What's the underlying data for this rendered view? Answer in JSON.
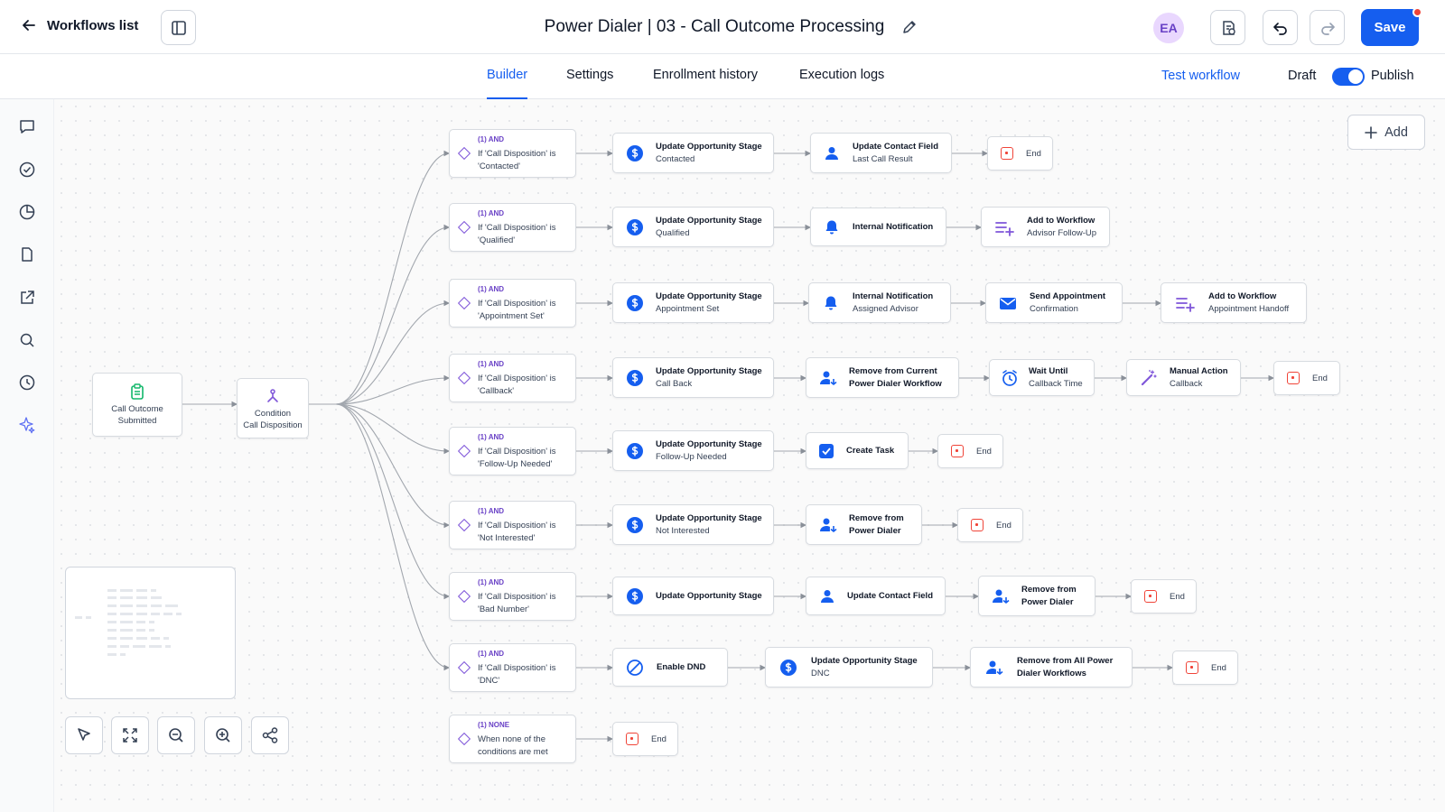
{
  "header": {
    "back_label": "Workflows list",
    "title": "Power Dialer | 03 - Call Outcome Processing",
    "avatar_initials": "EA",
    "save_label": "Save"
  },
  "tabs": [
    {
      "label": "Builder",
      "active": true
    },
    {
      "label": "Settings",
      "active": false
    },
    {
      "label": "Enrollment history",
      "active": false
    },
    {
      "label": "Execution logs",
      "active": false
    }
  ],
  "actions": {
    "test_workflow": "Test workflow",
    "draft_label": "Draft",
    "publish_label": "Publish",
    "publish_toggle_on": true
  },
  "canvas": {
    "add_label": "Add",
    "trigger": {
      "line1": "Call Outcome",
      "line2": "Submitted"
    },
    "condition": {
      "line1": "Condition",
      "line2": "Call Disposition"
    },
    "branch_tag": "(1) AND",
    "none_tag": "(1) NONE",
    "end_label": "End",
    "branches": [
      {
        "cond1": "If 'Call Disposition' is",
        "cond2": "'Contacted'"
      },
      {
        "cond1": "If 'Call Disposition' is",
        "cond2": "'Qualified'"
      },
      {
        "cond1": "If 'Call Disposition' is",
        "cond2": "'Appointment Set'"
      },
      {
        "cond1": "If 'Call Disposition' is",
        "cond2": "'Callback'"
      },
      {
        "cond1": "If 'Call Disposition' is",
        "cond2": "'Follow-Up Needed'"
      },
      {
        "cond1": "If 'Call Disposition' is",
        "cond2": "'Not Interested'"
      },
      {
        "cond1": "If 'Call Disposition' is",
        "cond2": "'Bad Number'"
      },
      {
        "cond1": "If 'Call Disposition' is",
        "cond2": "'DNC'"
      },
      {
        "cond1": "When none of the",
        "cond2": "conditions are met"
      }
    ],
    "actions": {
      "b0a1": {
        "title": "Update Opportunity Stage",
        "sub": "Contacted",
        "icon": "dollar-icon"
      },
      "b0a2": {
        "title": "Update Contact Field",
        "sub": "Last Call Result",
        "icon": "person-icon"
      },
      "b1a1": {
        "title": "Update Opportunity Stage",
        "sub": "Qualified",
        "icon": "dollar-icon"
      },
      "b1a2": {
        "title": "Internal Notification",
        "sub": "",
        "icon": "bell-icon"
      },
      "b1a3": {
        "title": "Add to Workflow",
        "sub": "Advisor Follow-Up",
        "icon": "list-add-icon"
      },
      "b2a1": {
        "title": "Update Opportunity Stage",
        "sub": "Appointment Set",
        "icon": "dollar-icon"
      },
      "b2a2": {
        "title": "Internal Notification",
        "sub": "Assigned Advisor",
        "icon": "bell-icon"
      },
      "b2a3": {
        "title": "Send Appointment",
        "sub": "Confirmation",
        "icon": "mail-icon"
      },
      "b2a4": {
        "title": "Add to Workflow",
        "sub": "Appointment Handoff",
        "icon": "list-add-icon"
      },
      "b3a1": {
        "title": "Update Opportunity Stage",
        "sub": "Call Back",
        "icon": "dollar-icon"
      },
      "b3a2": {
        "title": "Remove from Current",
        "sub": "Power Dialer Workflow",
        "icon": "person-remove-icon"
      },
      "b3a3": {
        "title": "Wait Until",
        "sub": "Callback Time",
        "icon": "clock-icon"
      },
      "b3a4": {
        "title": "Manual Action",
        "sub": "Callback",
        "icon": "wand-icon"
      },
      "b4a1": {
        "title": "Update Opportunity Stage",
        "sub": "Follow-Up Needed",
        "icon": "dollar-icon"
      },
      "b4a2": {
        "title": "Create Task",
        "sub": "",
        "icon": "task-icon"
      },
      "b5a1": {
        "title": "Update Opportunity Stage",
        "sub": "Not Interested",
        "icon": "dollar-icon"
      },
      "b5a2": {
        "title": "Remove from",
        "sub": "Power Dialer",
        "icon": "person-remove-icon"
      },
      "b6a1": {
        "title": "Update Opportunity Stage",
        "sub": "",
        "icon": "dollar-icon"
      },
      "b6a2": {
        "title": "Update Contact Field",
        "sub": "",
        "icon": "person-icon"
      },
      "b6a3": {
        "title": "Remove from",
        "sub": "Power Dialer",
        "icon": "person-remove-icon"
      },
      "b7a1": {
        "title": "Enable DND",
        "sub": "",
        "icon": "block-icon"
      },
      "b7a2": {
        "title": "Update Opportunity Stage",
        "sub": "DNC",
        "icon": "dollar-icon"
      },
      "b7a3": {
        "title": "Remove from All Power",
        "sub": "Dialer Workflows",
        "icon": "person-remove-icon"
      }
    }
  },
  "colors": {
    "accent": "#155eef",
    "condition_purple": "#7f56d9",
    "end_red": "#f04438",
    "node_icon_blue": "#155eef"
  }
}
